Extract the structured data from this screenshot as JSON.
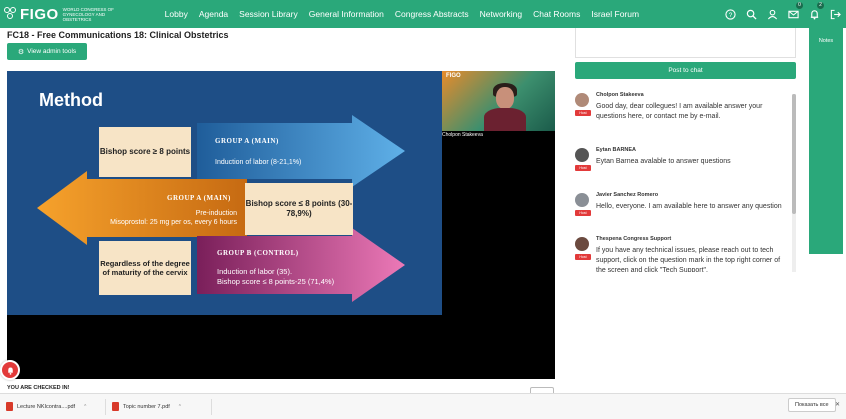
{
  "nav": {
    "logo": "FIGO",
    "logo_sub": "World Congress of Gynecology and Obstetrics",
    "links": [
      "Lobby",
      "Agenda",
      "Session Library",
      "General Information",
      "Congress Abstracts",
      "Networking",
      "Chat Rooms",
      "Israel Forum"
    ],
    "badges": {
      "messages": "0",
      "notifications": "2"
    }
  },
  "session": {
    "title": "FC18 - Free Communications 18: Clinical Obstetrics",
    "admin_button": "View admin tools"
  },
  "slide": {
    "title": "Method",
    "box1": "Bishop score ≥ 8 points",
    "group_a_main_1": "GROUP A (MAIN)",
    "text1": "Induction of labor (8-21,1%)",
    "group_a_main_2": "GROUP A (MAIN)",
    "text2_line1": "Pre-induction",
    "text2_line2": "Misoprostol: 25 mg per os, every 6 hours",
    "box2": "Bishop score ≤ 8 points (30-78,9%)",
    "box3": "Regardless of the degree of maturity of the cervix",
    "group_b": "GROUP B (CONTROL)",
    "text3_line1": "Induction of labor (35).",
    "text3_line2": "Bishop score ≤ 8 points-25 (71,4%)"
  },
  "camera": {
    "logo": "FIGO",
    "speaker": "Cholpon Stakeeva"
  },
  "status": {
    "checked_in": "YOU ARE CHECKED IN!"
  },
  "chat": {
    "post_button": "Post to chat",
    "host_badge": "Host",
    "messages": [
      {
        "name": "Cholpon Stakeeva",
        "text": "Good day, dear collegues! I am available answer your questions here, or contact me by e-mail."
      },
      {
        "name": "Eytan BARNEA",
        "text": "Eytan Barnea avalable to answer questions"
      },
      {
        "name": "Javier Sanchez Romero",
        "text": "Hello, everyone. I am available here to answer any question"
      },
      {
        "name": "Thespena Congress Support",
        "text": "If you have any technical issues, please reach out to tech support, click on the question mark in the top right corner of the screen and click \"Tech Support\"."
      }
    ]
  },
  "notes": {
    "label": "Notes"
  },
  "downloads": {
    "items": [
      "Lecture NKIcontra....pdf",
      "Topic number 7.pdf"
    ],
    "show_all": "Показать все"
  },
  "colors": {
    "brand_green": "#2aa87a",
    "slide_bg": "#1e4e86",
    "host_red": "#e23a3a"
  }
}
